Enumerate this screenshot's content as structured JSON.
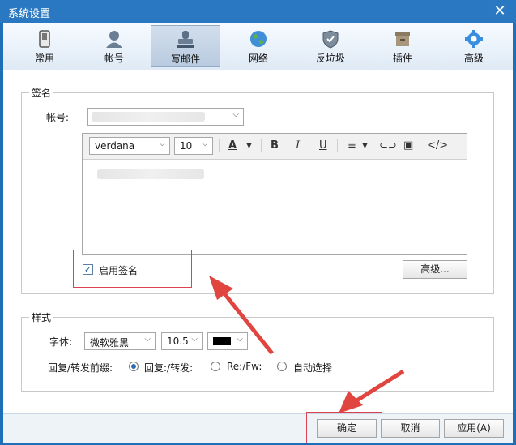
{
  "window": {
    "title": "系统设置",
    "close": "✕"
  },
  "tabs": [
    {
      "label": "常用",
      "icon": "phone-icon"
    },
    {
      "label": "帐号",
      "icon": "user-icon"
    },
    {
      "label": "写邮件",
      "icon": "stamp-icon",
      "active": true
    },
    {
      "label": "网络",
      "icon": "globe-icon"
    },
    {
      "label": "反垃圾",
      "icon": "shield-icon"
    },
    {
      "label": "插件",
      "icon": "box-icon"
    },
    {
      "label": "高级",
      "icon": "gear-icon"
    }
  ],
  "signature": {
    "section_title": "签名",
    "account_label": "帐号:",
    "font_family": "verdana",
    "font_size": "10",
    "enable_label": "启用签名",
    "enable_checked": true,
    "advanced_button": "高级..."
  },
  "style": {
    "section_title": "样式",
    "font_label": "字体:",
    "font_name": "微软雅黑",
    "font_size": "10.5",
    "font_color": "#000000",
    "prefix_label": "回复/转发前缀:",
    "options": [
      "回复:/转发:",
      "Re:/Fw:",
      "自动选择"
    ],
    "selected_option": 0
  },
  "footer": {
    "ok": "确定",
    "cancel": "取消",
    "apply": "应用(A)"
  },
  "colors": {
    "title_bar": "#2a78c2",
    "highlight": "#d9434f"
  }
}
